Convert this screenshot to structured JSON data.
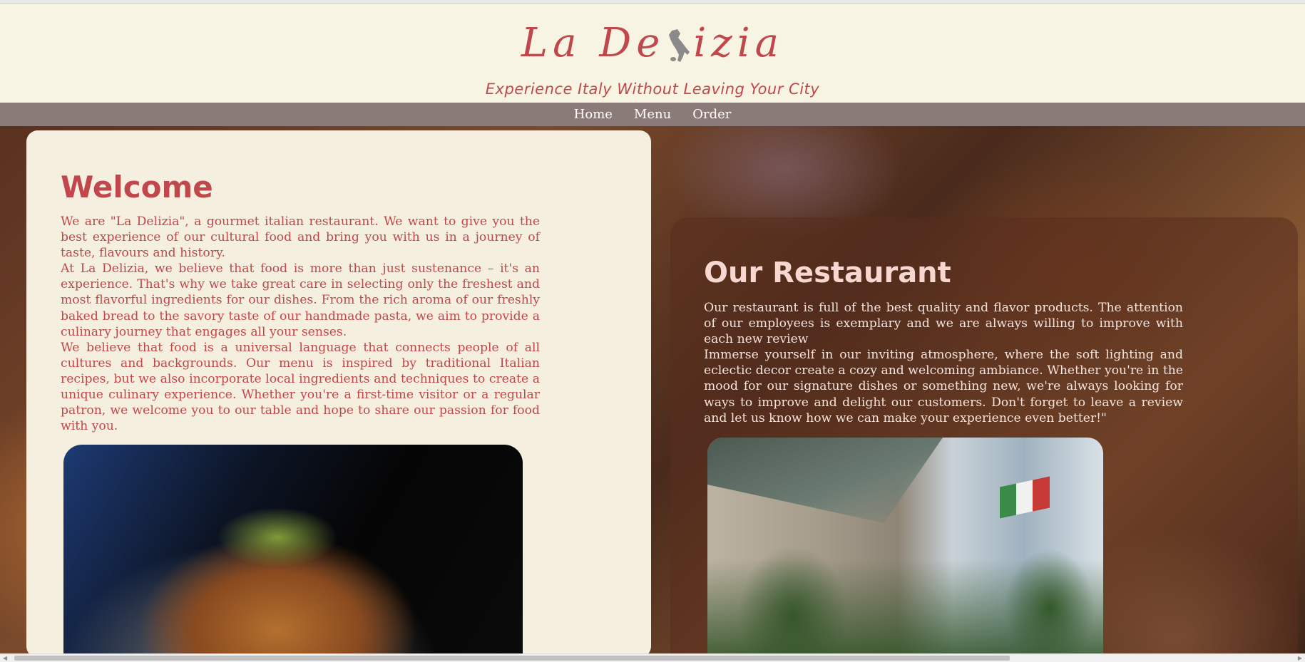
{
  "header": {
    "logo_text_left": "La De",
    "logo_text_right": "izia",
    "logo_icon": "italy-map-icon",
    "tagline": "Experience Italy Without Leaving Your City"
  },
  "nav": {
    "items": [
      {
        "label": "Home"
      },
      {
        "label": "Menu"
      },
      {
        "label": "Order"
      }
    ]
  },
  "welcome": {
    "title": "Welcome",
    "paragraphs": [
      "We are \"La Delizia\", a gourmet italian restaurant. We want to give you the best experience of our cultural food and bring you with us in a journey of taste, flavours and history.",
      "At La Delizia, we believe that food is more than just sustenance – it's an experience. That's why we take great care in selecting only the freshest and most flavorful ingredients for our dishes. From the rich aroma of our freshly baked bread to the savory taste of our handmade pasta, we aim to provide a culinary journey that engages all your senses.",
      "We believe that food is a universal language that connects people of all cultures and backgrounds. Our menu is inspired by traditional Italian recipes, but we also incorporate local ingredients and techniques to create a unique culinary experience. Whether you're a first-time visitor or a regular patron, we welcome you to our table and hope to share our passion for food with you."
    ],
    "image": "pasta-dish-photo"
  },
  "restaurant": {
    "title": "Our Restaurant",
    "paragraphs": [
      "Our restaurant is full of the best quality and flavor products. The attention of our employees is exemplary and we are always willing to improve with each new review",
      "Immerse yourself in our inviting atmosphere, where the soft lighting and eclectic decor create a cozy and welcoming ambiance. Whether you're in the mood for our signature dishes or something new, we're always looking for ways to improve and delight our customers. Don't forget to leave a review and let us know how we can make your experience even better!\""
    ],
    "image": "restaurant-building-photo"
  },
  "colors": {
    "brand_red": "#c0474b",
    "header_bg": "#f8f4e3",
    "nav_bg": "#8b7b78",
    "card_bg": "#f4efde",
    "restaurant_title": "#f7d7cf"
  },
  "scrollbar": {
    "horizontal_thumb_fraction": 0.78
  }
}
